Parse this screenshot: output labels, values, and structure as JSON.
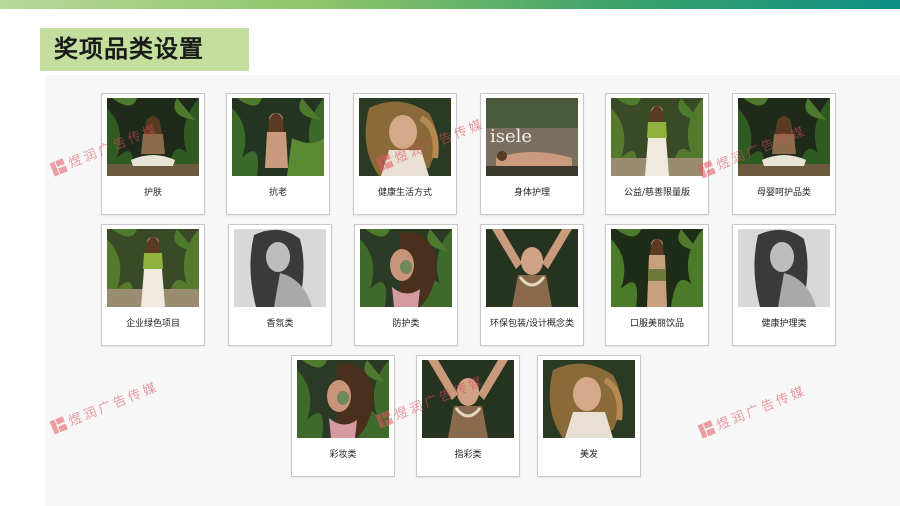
{
  "page": {
    "title": "奖项品类设置",
    "watermark_text": "煜润广告传媒"
  },
  "awards": [
    {
      "label": "护肤",
      "photo": "meditating-woman-in-jungle-photo"
    },
    {
      "label": "抗老",
      "photo": "woman-among-palm-leaves-photo"
    },
    {
      "label": "健康生活方式",
      "photo": "curly-hair-woman-portrait-photo"
    },
    {
      "label": "身体护理",
      "photo": "woman-lying-magazine-cover-photo"
    },
    {
      "label": "公益/慈善限量版",
      "photo": "woman-green-top-jungle-photo"
    },
    {
      "label": "母婴呵护品类",
      "photo": "meditating-woman-in-jungle-photo"
    },
    {
      "label": "企业绿色项目",
      "photo": "woman-green-top-jungle-photo"
    },
    {
      "label": "香氛类",
      "photo": "black-white-woman-portrait-photo"
    },
    {
      "label": "防护类",
      "photo": "woman-clay-mask-profile-photo"
    },
    {
      "label": "环保包装/设计概念类",
      "photo": "woman-with-necklace-arms-up-photo"
    },
    {
      "label": "口服美丽饮品",
      "photo": "woman-standing-in-jungle-photo"
    },
    {
      "label": "健康护理类",
      "photo": "black-white-woman-portrait-photo"
    },
    {
      "label": "彩妆类",
      "photo": "woman-clay-mask-profile-photo"
    },
    {
      "label": "指彩类",
      "photo": "woman-with-necklace-arms-up-photo"
    },
    {
      "label": "美发",
      "photo": "curly-hair-woman-portrait-photo"
    }
  ],
  "colors": {
    "title_band": "#c4df9d",
    "watermark": "#e3545f",
    "top_gradient_start": "#b7d89a",
    "top_gradient_end": "#0d8f86"
  }
}
